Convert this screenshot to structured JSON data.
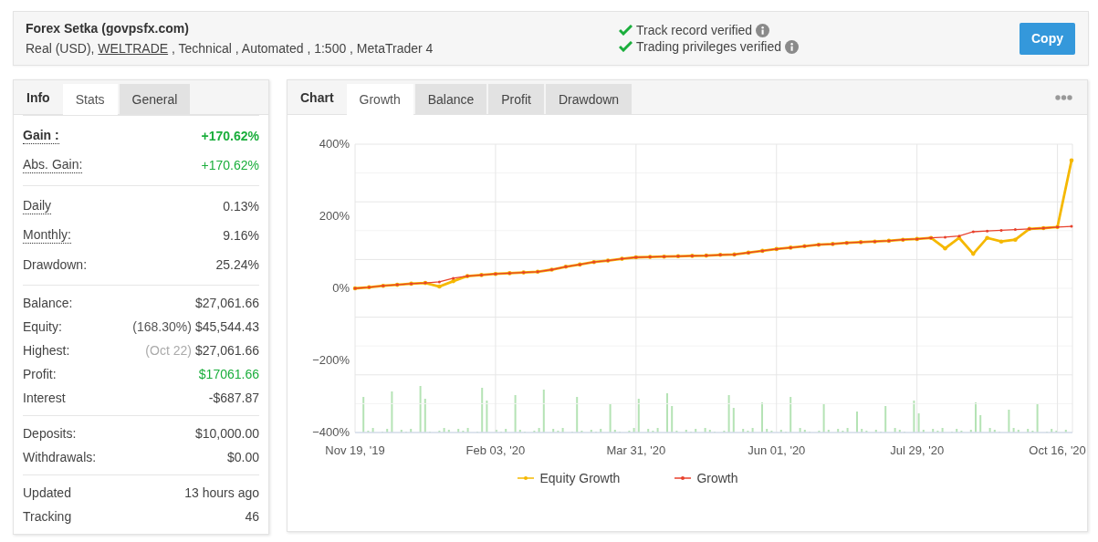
{
  "header": {
    "title": "Forex Setka (govpsfx.com)",
    "subtitle": {
      "before": "Real (USD), ",
      "link": "WELTRADE",
      "after": " , Technical , Automated , 1:500 , MetaTrader 4"
    },
    "verifications": [
      {
        "text": "Track record verified",
        "verified": true
      },
      {
        "text": "Trading privileges verified",
        "verified": true
      }
    ],
    "button": "Copy"
  },
  "stats_panel": {
    "title": "Info",
    "tabs": [
      {
        "label": "Stats",
        "selected": true
      },
      {
        "label": "General",
        "selected": false
      }
    ],
    "groups": [
      [
        {
          "label": "Gain :",
          "value": "+170.62%",
          "bold": true,
          "dotted": true,
          "positive": true
        },
        {
          "label": "Abs. Gain:",
          "value": "+170.62%",
          "bold": false,
          "dotted": true,
          "positive": true
        }
      ],
      [
        {
          "label": "Daily",
          "value": "0.13%",
          "bold": false,
          "dotted": true,
          "positive": false
        },
        {
          "label": "Monthly:",
          "value": "9.16%",
          "bold": false,
          "dotted": true,
          "positive": false
        },
        {
          "label": "Drawdown:",
          "value": "25.24%",
          "bold": false,
          "dotted": false,
          "positive": false
        }
      ],
      [
        {
          "label": "Balance:",
          "value": "$27,061.66",
          "bold": false,
          "dotted": false,
          "positive": false
        },
        {
          "label": "Equity:",
          "note": {
            "text": "(168.30%)",
            "muted": false
          },
          "value": "$45,544.43",
          "bold": false,
          "dotted": false,
          "positive": false
        },
        {
          "label": "Highest:",
          "note": {
            "text": "(Oct 22)",
            "muted": true
          },
          "value": "$27,061.66",
          "bold": false,
          "dotted": false,
          "positive": false
        },
        {
          "label": "Profit:",
          "value": "$17061.66",
          "bold": false,
          "dotted": false,
          "positive": true
        },
        {
          "label": "Interest",
          "value": "-$687.87",
          "bold": false,
          "dotted": false,
          "positive": false
        }
      ],
      [
        {
          "label": "Deposits:",
          "value": "$10,000.00",
          "bold": false,
          "dotted": false,
          "positive": false
        },
        {
          "label": "Withdrawals:",
          "value": "$0.00",
          "bold": false,
          "dotted": false,
          "positive": false
        }
      ],
      [
        {
          "label": "Updated",
          "value": "13 hours ago",
          "bold": false,
          "dotted": false,
          "positive": false
        },
        {
          "label": "Tracking",
          "value": "46",
          "bold": false,
          "dotted": false,
          "positive": false
        }
      ]
    ]
  },
  "chart_panel": {
    "title": "Chart",
    "tabs": [
      {
        "label": "Growth",
        "selected": true
      },
      {
        "label": "Balance",
        "selected": false
      },
      {
        "label": "Profit",
        "selected": false
      },
      {
        "label": "Drawdown",
        "selected": false
      }
    ],
    "chart_data": {
      "type": "line",
      "ylim": [
        -400,
        400
      ],
      "grid": true,
      "legend": true,
      "categories": [
        "Nov 19, '19",
        null,
        null,
        null,
        null,
        null,
        null,
        null,
        null,
        null,
        "Feb 03, '20",
        null,
        null,
        null,
        null,
        null,
        null,
        null,
        null,
        null,
        "Mar 31, '20",
        null,
        null,
        null,
        null,
        null,
        null,
        null,
        null,
        null,
        "Jun 01, '20",
        null,
        null,
        null,
        null,
        null,
        null,
        null,
        null,
        null,
        "Jul 29, '20",
        null,
        null,
        null,
        null,
        null,
        null,
        null,
        null,
        null,
        "Oct 16, '20",
        null
      ],
      "yticks": [
        {
          "value": 400,
          "label": "400%"
        },
        {
          "value": 200,
          "label": "200%"
        },
        {
          "value": 0,
          "label": "0%"
        },
        {
          "value": -200,
          "label": "−200%"
        },
        {
          "value": -400,
          "label": "−400%"
        }
      ],
      "series": [
        {
          "name": "Equity Growth",
          "color": "#f5b800",
          "values": [
            0,
            3,
            7,
            10,
            13,
            15,
            5,
            20,
            34,
            37,
            40,
            42,
            44,
            46,
            52,
            60,
            66,
            73,
            77,
            82,
            86,
            87,
            88,
            89,
            90,
            91,
            93,
            94,
            99,
            104,
            109,
            113,
            117,
            121,
            123,
            126,
            128,
            130,
            132,
            135,
            137,
            140,
            111,
            140,
            96,
            140,
            130,
            135,
            165,
            167,
            170,
            355
          ]
        },
        {
          "name": "Growth",
          "color": "#e8412c",
          "values": [
            0,
            3,
            7,
            10,
            13,
            15,
            18,
            28,
            34,
            37,
            40,
            42,
            44,
            46,
            52,
            60,
            66,
            73,
            77,
            82,
            86,
            87,
            88,
            89,
            90,
            91,
            93,
            94,
            99,
            104,
            109,
            113,
            117,
            121,
            123,
            126,
            128,
            130,
            132,
            135,
            137,
            140,
            142,
            145,
            157,
            159,
            161,
            163,
            165,
            167,
            170,
            172
          ]
        }
      ]
    }
  }
}
